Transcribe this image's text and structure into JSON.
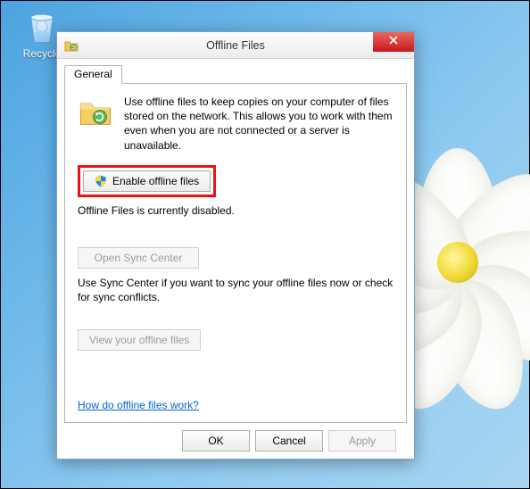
{
  "desktop": {
    "recycle_label": "Recycle"
  },
  "dialog": {
    "title": "Offline Files",
    "tabs": {
      "general": "General"
    },
    "intro": "Use offline files to keep copies on your computer of files stored on the network.  This allows you to work with them even when you are not connected or a server is unavailable.",
    "enable_button": "Enable offline files",
    "status": "Offline Files is currently disabled.",
    "open_sync_button": "Open Sync Center",
    "sync_desc": "Use Sync Center if you want to sync your offline files now or check for sync conflicts.",
    "view_button": "View your offline files",
    "help_link": "How do offline files work?",
    "buttons": {
      "ok": "OK",
      "cancel": "Cancel",
      "apply": "Apply"
    }
  }
}
